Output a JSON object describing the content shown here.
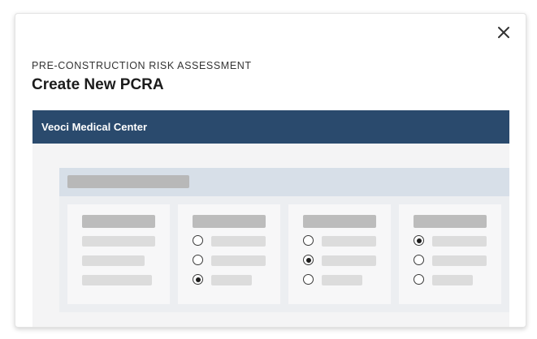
{
  "modal": {
    "eyebrow": "PRE-CONSTRUCTION RISK ASSESSMENT",
    "title": "Create New PCRA",
    "close_icon": "close-icon"
  },
  "preview": {
    "header_title": "Veoci Medical Center",
    "colors": {
      "header_bg": "#2a4a6d",
      "band_bg": "#d7dfe8",
      "placeholder": "#dcdcdc"
    },
    "cards": [
      {
        "type": "labels"
      },
      {
        "type": "radio-group",
        "selected_index": 2
      },
      {
        "type": "radio-group",
        "selected_index": 1
      },
      {
        "type": "radio-group",
        "selected_index": 0
      }
    ]
  }
}
